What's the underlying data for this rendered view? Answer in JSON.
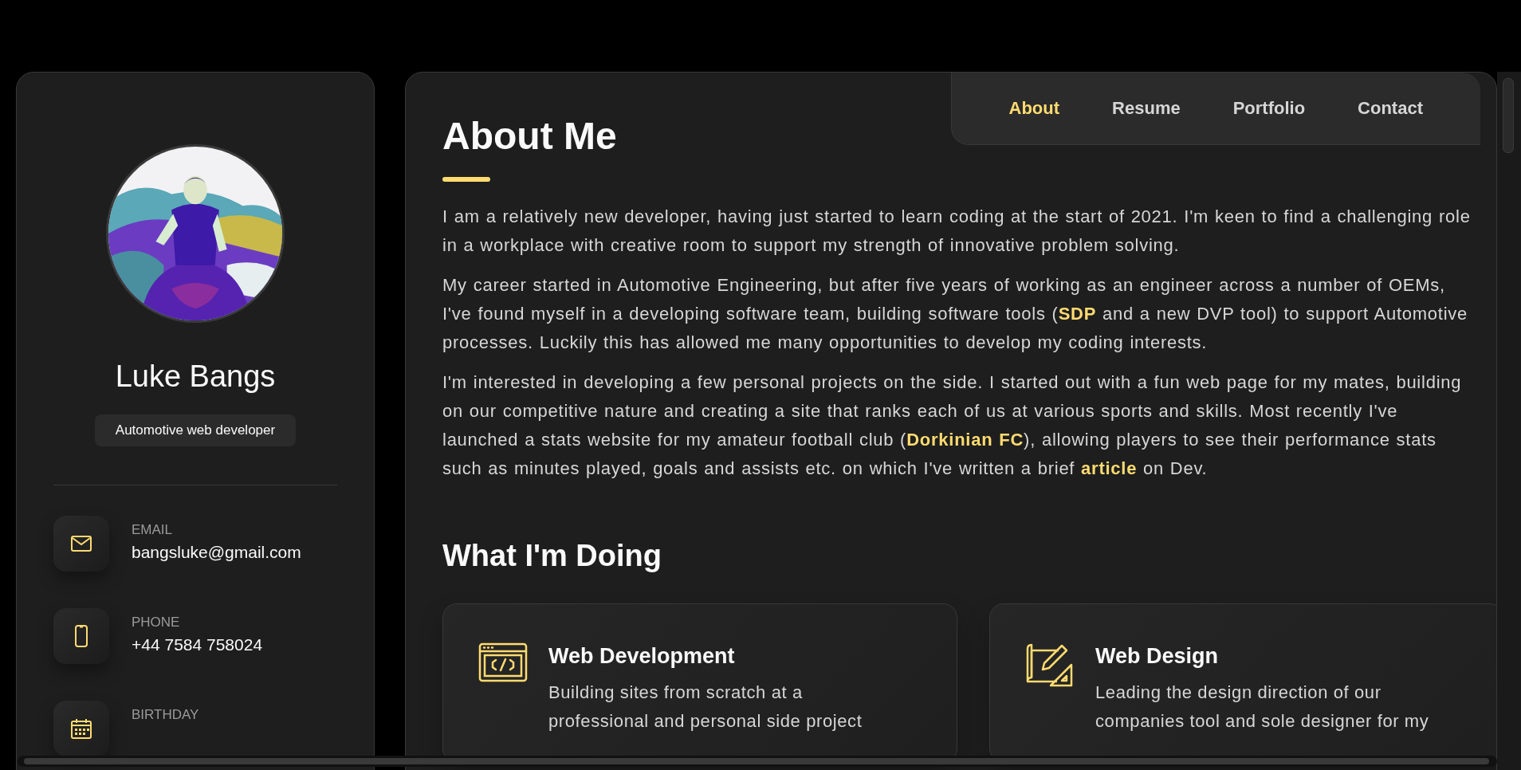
{
  "profile": {
    "name": "Luke Bangs",
    "title": "Automotive web developer"
  },
  "contacts": [
    {
      "kind": "email",
      "label": "EMAIL",
      "value": "bangsluke@gmail.com"
    },
    {
      "kind": "phone",
      "label": "PHONE",
      "value": "+44 7584 758024"
    },
    {
      "kind": "birthday",
      "label": "BIRTHDAY"
    }
  ],
  "nav": [
    {
      "label": "About",
      "selected": true
    },
    {
      "label": "Resume",
      "selected": false
    },
    {
      "label": "Portfolio",
      "selected": false
    },
    {
      "label": "Contact",
      "selected": false
    }
  ],
  "about": {
    "title": "About Me",
    "paragraphs": [
      [
        {
          "kind": "text",
          "text": "I am a relatively new developer, having just started to learn coding at the start of 2021. I'm keen to find a challenging role in a workplace with creative room to support my strength of innovative problem solving."
        }
      ],
      [
        {
          "kind": "text",
          "text": "My career started in Automotive Engineering, but after five years of working as an engineer across a number of OEMs, I've found myself in a developing software team, building software tools ("
        },
        {
          "kind": "link",
          "text": "SDP"
        },
        {
          "kind": "text",
          "text": " and a new DVP tool) to support Automotive processes. Luckily this has allowed me many opportunities to develop my coding interests."
        }
      ],
      [
        {
          "kind": "text",
          "text": "I'm interested in developing a few personal projects on the side. I started out with a fun web page for my mates, building on our competitive nature and creating a site that ranks each of us at various sports and skills. Most recently I've launched a stats website for my amateur football club ("
        },
        {
          "kind": "link",
          "text": "Dorkinian FC"
        },
        {
          "kind": "text",
          "text": "), allowing players to see their performance stats such as minutes played, goals and assists etc. on which I've written a brief "
        },
        {
          "kind": "link",
          "text": "article"
        },
        {
          "kind": "text",
          "text": " on Dev."
        }
      ]
    ]
  },
  "services": {
    "title": "What I'm Doing",
    "items": [
      {
        "kind": "code",
        "title": "Web Development",
        "text": "Building sites from scratch at a professional and personal side project"
      },
      {
        "kind": "design",
        "title": "Web Design",
        "text": "Leading the design direction of our companies tool and sole designer for my"
      }
    ]
  }
}
